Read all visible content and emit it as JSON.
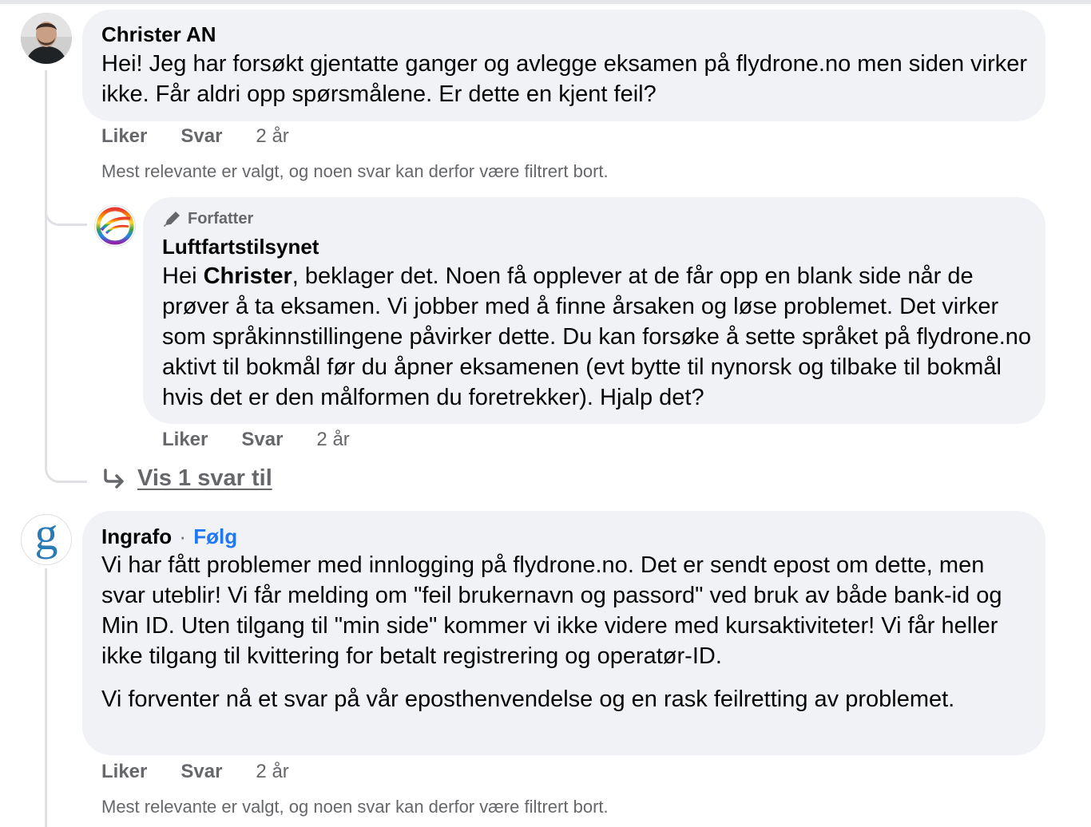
{
  "comments": [
    {
      "author": "Christer AN",
      "text": "Hei! Jeg har forsøkt gjentatte ganger og avlegge eksamen på flydrone.no men siden virker ikke. Får aldri opp spørsmålene. Er dette en kjent feil?",
      "actions": {
        "like": "Liker",
        "reply": "Svar",
        "time": "2 år"
      },
      "filter_note": "Mest relevante er valgt, og noen svar kan derfor være filtrert bort.",
      "reply": {
        "badge": "Forfatter",
        "badge_icon": "pencil-icon",
        "author": "Luftfartstilsynet",
        "text_pre": "Hei ",
        "text_bold": "Christer",
        "text_post": ", beklager det. Noen få opplever at de får opp en blank side når de prøver å ta eksamen. Vi jobber med å finne årsaken og løse problemet. Det virker som språkinnstillingene påvirker dette. Du kan forsøke å sette språket på flydrone.no aktivt til bokmål før du åpner eksamenen (evt bytte til nynorsk og tilbake til bokmål hvis det er den målformen du foretrekker). Hjalp det?",
        "actions": {
          "like": "Liker",
          "reply": "Svar",
          "time": "2 år"
        }
      },
      "more_replies": "Vis 1 svar til"
    },
    {
      "author": "Ingrafo",
      "separator": "·",
      "follow": "Følg",
      "avatar_letter": "g",
      "paragraphs": [
        "Vi har fått problemer med innlogging på flydrone.no. Det er sendt epost om dette, men svar uteblir! Vi får melding om \"feil brukernavn og passord\" ved bruk av både bank-id og Min ID. Uten tilgang til \"min side\" kommer vi ikke videre med kursaktiviteter! Vi får heller ikke tilgang til kvittering for betalt registrering og operatør-ID.",
        "Vi forventer nå et svar på vår eposthenvendelse og en rask feilretting av problemet."
      ],
      "actions": {
        "like": "Liker",
        "reply": "Svar",
        "time": "2 år"
      },
      "filter_note": "Mest relevante er valgt, og noen svar kan derfor være filtrert bort."
    }
  ]
}
